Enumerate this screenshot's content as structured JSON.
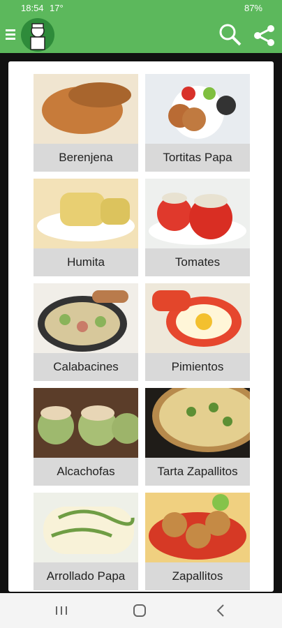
{
  "status_bar": {
    "time": "18:54",
    "temperature": "17°",
    "battery": "87%"
  },
  "app_bar": {
    "logo_icon": "chef-icon",
    "menu_icon": "menu-icon",
    "search_icon": "search-icon",
    "share_icon": "share-icon"
  },
  "recipes": [
    {
      "label": "Berenjena",
      "image": "fried-eggplant"
    },
    {
      "label": "Tortitas Papa",
      "image": "potato-patties"
    },
    {
      "label": "Humita",
      "image": "humita-tamales"
    },
    {
      "label": "Tomates",
      "image": "stuffed-tomatoes"
    },
    {
      "label": "Calabacines",
      "image": "zucchini-pan"
    },
    {
      "label": "Pimientos",
      "image": "egg-in-peppers"
    },
    {
      "label": "Alcachofas",
      "image": "stuffed-artichokes"
    },
    {
      "label": "Tarta Zapallitos",
      "image": "zucchini-tart"
    },
    {
      "label": "Arrollado Papa",
      "image": "potato-roll"
    },
    {
      "label": "Zapallitos",
      "image": "zucchini-slices"
    }
  ],
  "nav_bar": {
    "recent_icon": "recent-apps-icon",
    "home_icon": "home-icon",
    "back_icon": "back-icon"
  }
}
